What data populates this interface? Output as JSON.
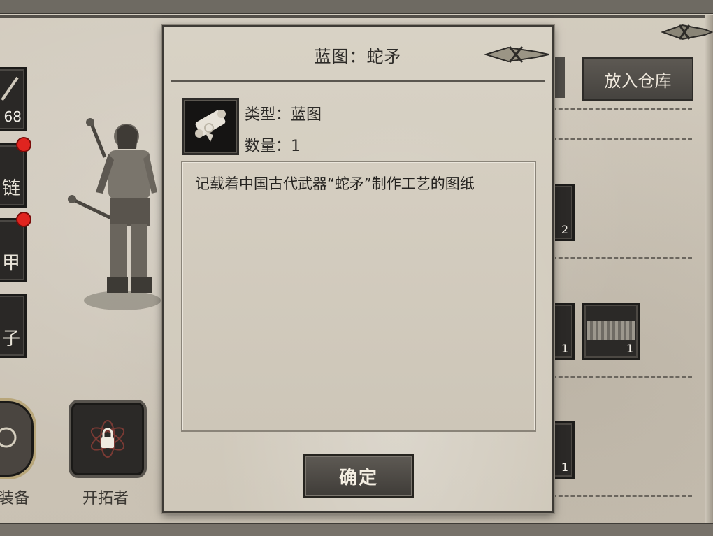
{
  "dialog": {
    "title": "蓝图：蛇矛",
    "type_label": "类型：蓝图",
    "quantity_label": "数量：1",
    "description": "记载着中国古代武器“蛇矛”制作工艺的图纸",
    "confirm_label": "确定"
  },
  "left_panel": {
    "slots": [
      {
        "text": "68"
      },
      {
        "text": "链"
      },
      {
        "text": "甲"
      },
      {
        "text": "子"
      }
    ],
    "bottom_buttons": [
      {
        "label": "装备"
      },
      {
        "label": "开拓者"
      }
    ]
  },
  "right_panel": {
    "store_button_label": "放入仓库",
    "inventory_counts": [
      "2",
      "1",
      "1",
      "1"
    ]
  },
  "colors": {
    "parchment": "#d3ccbf",
    "dark_slot": "#2a2826",
    "notification_red": "#e0241f",
    "button_dark": "#4f4b46"
  }
}
